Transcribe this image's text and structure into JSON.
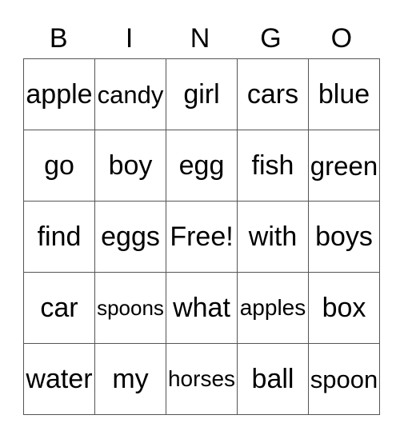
{
  "header": [
    "B",
    "I",
    "N",
    "G",
    "O"
  ],
  "rows": [
    [
      "apple",
      "candy",
      "girl",
      "cars",
      "blue"
    ],
    [
      "go",
      "boy",
      "egg",
      "fish",
      "green"
    ],
    [
      "find",
      "eggs",
      "Free!",
      "with",
      "boys"
    ],
    [
      "car",
      "spoons",
      "what",
      "apples",
      "box"
    ],
    [
      "water",
      "my",
      "horses",
      "ball",
      "spoon"
    ]
  ]
}
